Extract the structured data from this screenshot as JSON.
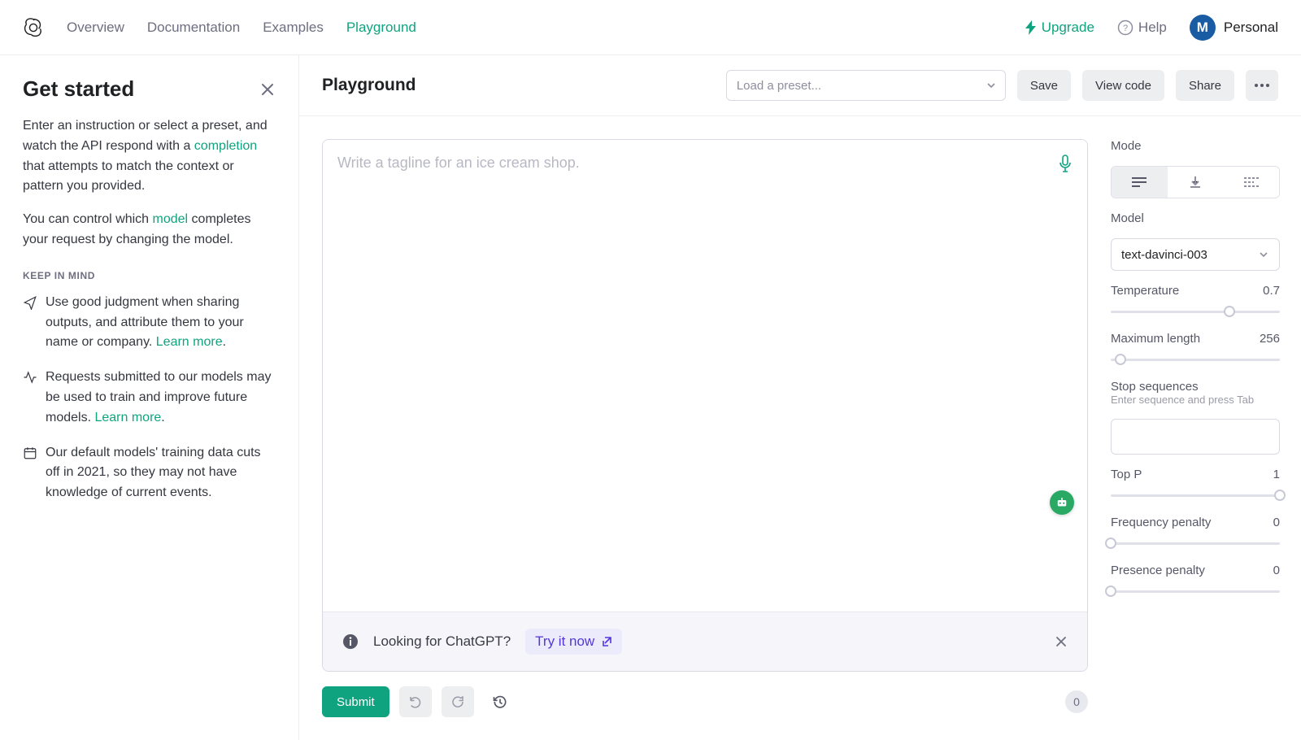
{
  "nav": {
    "links": [
      "Overview",
      "Documentation",
      "Examples",
      "Playground"
    ],
    "active_index": 3,
    "upgrade": "Upgrade",
    "help": "Help",
    "avatar_letter": "M",
    "account_label": "Personal"
  },
  "sidebar": {
    "title": "Get started",
    "para1_pre": "Enter an instruction or select a preset, and watch the API respond with a ",
    "para1_link": "completion",
    "para1_post": " that attempts to match the context or pattern you provided.",
    "para2_pre": "You can control which ",
    "para2_link": "model",
    "para2_post": " completes your request by changing the model.",
    "kicker": "KEEP IN MIND",
    "tips": [
      {
        "text_pre": "Use good judgment when sharing outputs, and attribute them to your name or company. ",
        "link": "Learn more",
        "text_post": "."
      },
      {
        "text_pre": "Requests submitted to our models may be used to train and improve future models. ",
        "link": "Learn more",
        "text_post": "."
      },
      {
        "text_pre": "Our default models' training data cuts off in 2021, so they may not have knowledge of current events.",
        "link": "",
        "text_post": ""
      }
    ]
  },
  "toolbar": {
    "title": "Playground",
    "preset_placeholder": "Load a preset...",
    "save": "Save",
    "view_code": "View code",
    "share": "Share"
  },
  "editor": {
    "placeholder": "Write a tagline for an ice cream shop.",
    "banner_text": "Looking for ChatGPT?",
    "try_label": "Try it now",
    "submit": "Submit",
    "token_count": "0"
  },
  "settings": {
    "mode_label": "Mode",
    "model_label": "Model",
    "model_value": "text-davinci-003",
    "params": [
      {
        "name": "Temperature",
        "value": "0.7",
        "pct": 70
      },
      {
        "name": "Maximum length",
        "value": "256",
        "pct": 6
      },
      {
        "name": "Top P",
        "value": "1",
        "pct": 100
      },
      {
        "name": "Frequency penalty",
        "value": "0",
        "pct": 0
      },
      {
        "name": "Presence penalty",
        "value": "0",
        "pct": 0
      }
    ],
    "stop_label": "Stop sequences",
    "stop_hint": "Enter sequence and press Tab"
  }
}
